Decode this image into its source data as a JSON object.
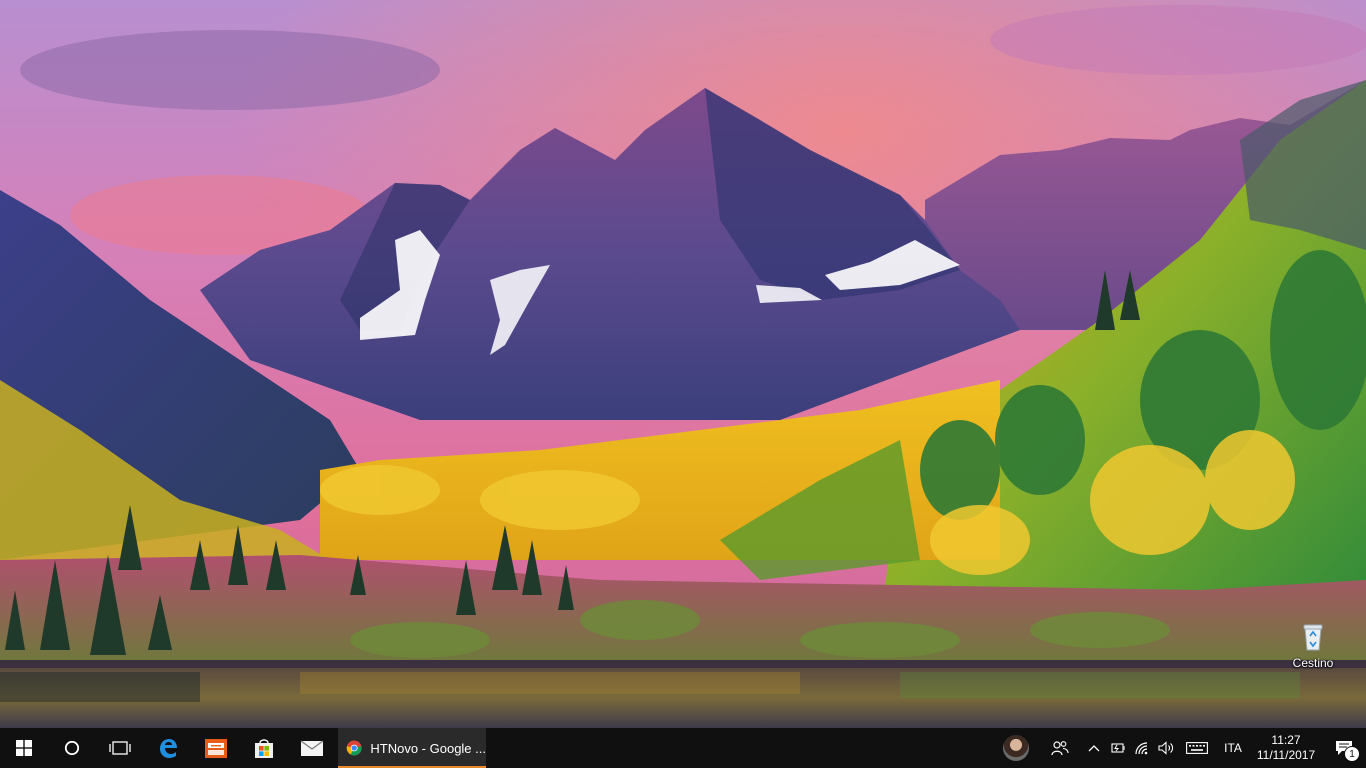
{
  "desktop": {
    "wallpaper": "Maroon Bells mountains at sunset with autumn aspen forest and lake",
    "icons": [
      {
        "label": "Cestino",
        "icon": "recycle-bin-icon"
      }
    ]
  },
  "taskbar": {
    "pinned": [
      {
        "name": "start-button",
        "icon": "windows-logo-icon"
      },
      {
        "name": "cortana-button",
        "icon": "circle-icon"
      },
      {
        "name": "task-view-button",
        "icon": "task-view-icon"
      },
      {
        "name": "edge-button",
        "icon": "edge-icon"
      },
      {
        "name": "file-explorer-button",
        "icon": "folder-icon"
      },
      {
        "name": "store-button",
        "icon": "store-bag-icon"
      },
      {
        "name": "mail-button",
        "icon": "mail-icon"
      }
    ],
    "active_app": {
      "title": "HTNovo - Google ...",
      "icon": "chrome-icon",
      "accent": "#e8872a"
    },
    "tray": {
      "language": "ITA",
      "time": "11:27",
      "date": "11/11/2017",
      "notification_count": "1"
    }
  },
  "colors": {
    "taskbar": "#101010",
    "active_app_bg": "#2a2a2a",
    "edge_blue": "#1f8fe0",
    "explorer_orange": "#e85c1a"
  }
}
